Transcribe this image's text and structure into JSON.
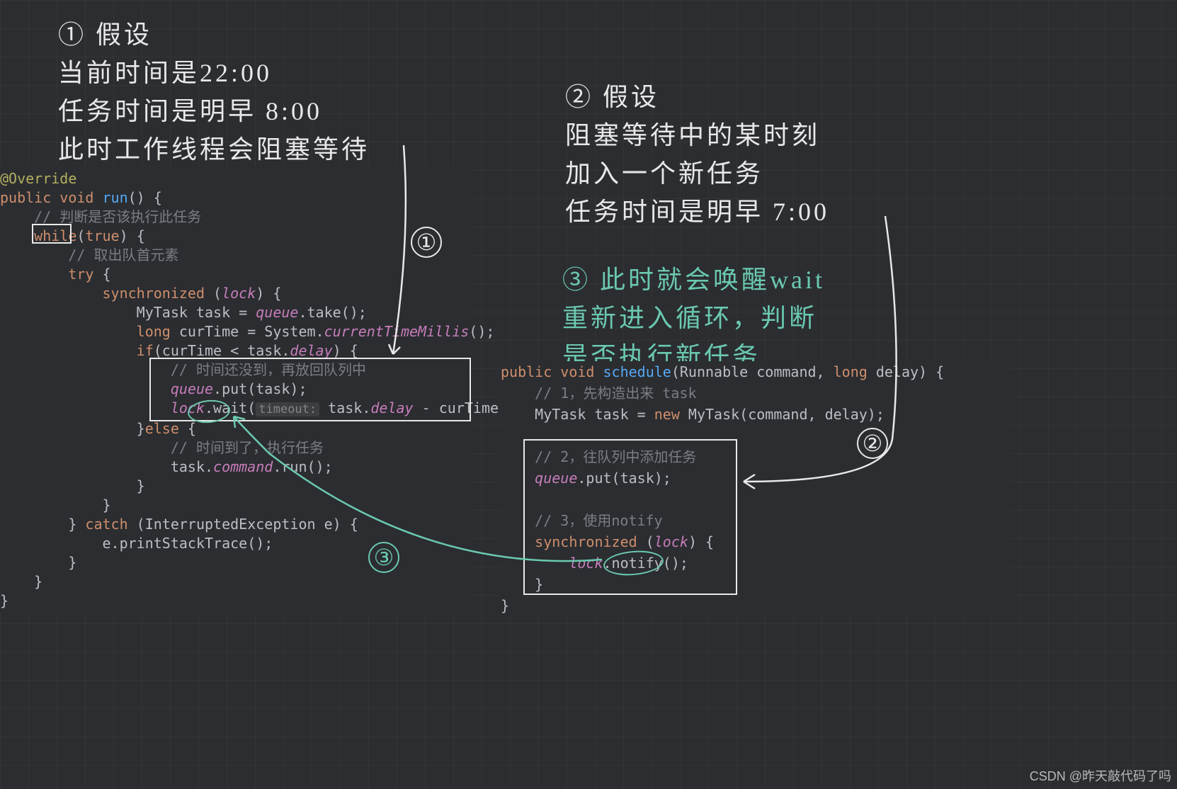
{
  "annotations": {
    "note1_marker": "①",
    "note1_heading": "假设",
    "note1_line1": "当前时间是22:00",
    "note1_line2": "任务时间是明早 8:00",
    "note1_line3": "此时工作线程会阻塞等待",
    "note2_marker": "②",
    "note2_heading": "假设",
    "note2_line1": "阻塞等待中的某时刻",
    "note2_line2": "加入一个新任务",
    "note2_line3": "任务时间是明早 7:00",
    "note3_marker": "③",
    "note3_line1": "此时就会唤醒wait",
    "note3_line2": "重新进入循环，判断",
    "note3_line3": "是否执行新任务"
  },
  "code_left": {
    "l1": "@Override",
    "l2_kw1": "public",
    "l2_kw2": "void",
    "l2_method": "run",
    "l2_rest": "() {",
    "l3_comment": "// 判断是否该执行此任务",
    "l4_kw": "while",
    "l4_cond": "(",
    "l4_true": "true",
    "l4_rest": ") {",
    "l5_comment": "// 取出队首元素",
    "l6_kw": "try",
    "l6_rest": " {",
    "l7_kw": "synchronized",
    "l7_rest": " (",
    "l7_lock": "lock",
    "l7_end": ") {",
    "l8_type": "MyTask",
    "l8_var": " task = ",
    "l8_queue": "queue",
    "l8_take": ".take();",
    "l9_kw": "long",
    "l9_var": " curTime = System.",
    "l9_call": "currentTimeMillis",
    "l9_end": "();",
    "l10_kw": "if",
    "l10_rest": "(curTime < task.",
    "l10_delay": "delay",
    "l10_end": ") {",
    "l11_comment": "// 时间还没到，再放回队列中",
    "l12_queue": "queue",
    "l12_rest": ".put(task);",
    "l13_lock": "lock",
    "l13_wait": ".wait(",
    "l13_hint": "timeout:",
    "l13_rest": " task.",
    "l13_delay": "delay",
    "l13_end": " - curTime);",
    "l14": "}",
    "l14_kw": "else",
    "l14_rest": " {",
    "l15_comment": "// 时间到了，执行任务",
    "l16": "task.",
    "l16_cmd": "command",
    "l16_rest": ".run();",
    "l17": "}",
    "l18": "}",
    "l19": "} ",
    "l19_kw": "catch",
    "l19_rest": " (InterruptedException e) {",
    "l20": "e.printStackTrace();",
    "l21": "}",
    "l22": "}",
    "l23": "}"
  },
  "code_right": {
    "r1_kw1": "public",
    "r1_kw2": "void",
    "r1_method": "schedule",
    "r1_sig": "(Runnable command, ",
    "r1_kw3": "long",
    "r1_rest": " delay) {",
    "r2_comment": "// 1，先构造出来 task",
    "r3_type": "MyTask",
    "r3_rest": " task = ",
    "r3_kw": "new",
    "r3_call": " MyTask(command, delay);",
    "r4_comment": "// 2，往队列中添加任务",
    "r5_queue": "queue",
    "r5_rest": ".put(task);",
    "r6_comment": "// 3，使用notify",
    "r7_kw": "synchronized",
    "r7_rest": " (",
    "r7_lock": "lock",
    "r7_end": ") {",
    "r8_lock": "lock",
    "r8_rest": ".notify();",
    "r9": "}",
    "r10": "}"
  },
  "markers": {
    "m1": "①",
    "m2": "②",
    "m3": "③"
  },
  "watermark": "CSDN @昨天敲代码了吗"
}
